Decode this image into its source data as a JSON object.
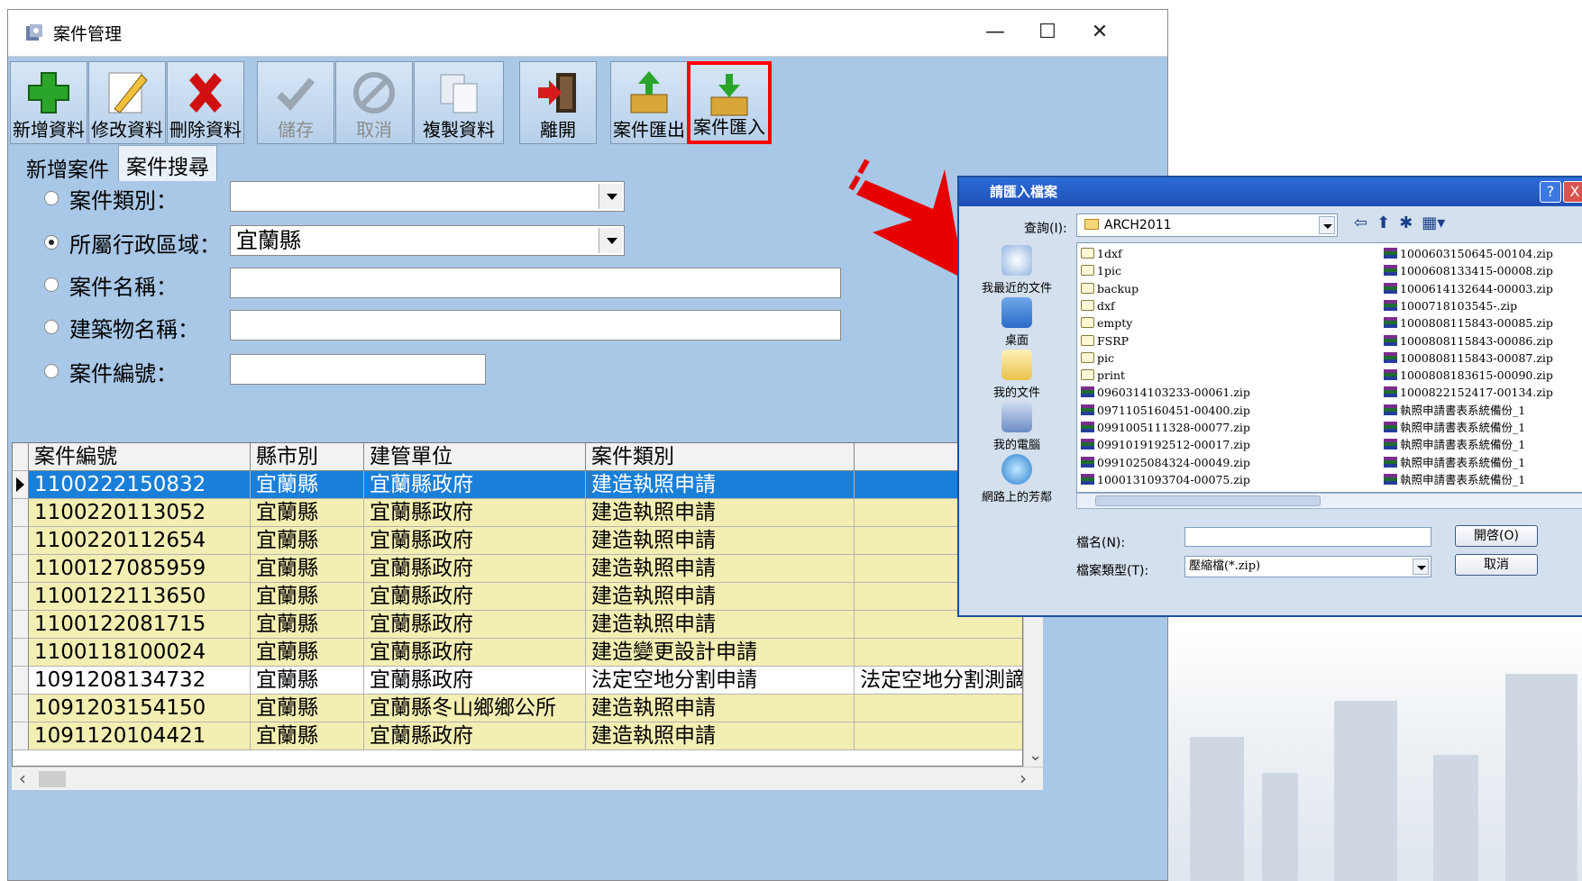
{
  "window": {
    "title": "案件管理",
    "controls": {
      "minimize": "—",
      "maximize": "☐",
      "close": "✕"
    }
  },
  "toolbar": {
    "add": "新增資料",
    "edit": "修改資料",
    "delete": "刪除資料",
    "save": "儲存",
    "cancel": "取消",
    "copy": "複製資料",
    "exit": "離開",
    "export": "案件匯出",
    "import": "案件匯入"
  },
  "tabs": {
    "new_case": "新增案件",
    "search": "案件搜尋"
  },
  "search_form": {
    "case_type_label": "案件類別：",
    "case_type_value": "",
    "district_label": "所屬行政區域：",
    "district_value": "宜蘭縣",
    "case_name_label": "案件名稱：",
    "building_name_label": "建築物名稱：",
    "case_no_label": "案件編號："
  },
  "grid": {
    "columns": [
      "案件編號",
      "縣市別",
      "建管單位",
      "案件類別",
      ""
    ],
    "rows": [
      {
        "cells": [
          "1100222150832",
          "宜蘭縣",
          "宜蘭縣政府",
          "建造執照申請",
          ""
        ],
        "style": "sel"
      },
      {
        "cells": [
          "1100220113052",
          "宜蘭縣",
          "宜蘭縣政府",
          "建造執照申請",
          ""
        ],
        "style": "yellow"
      },
      {
        "cells": [
          "1100220112654",
          "宜蘭縣",
          "宜蘭縣政府",
          "建造執照申請",
          ""
        ],
        "style": "yellow"
      },
      {
        "cells": [
          "1100127085959",
          "宜蘭縣",
          "宜蘭縣政府",
          "建造執照申請",
          ""
        ],
        "style": "yellow"
      },
      {
        "cells": [
          "1100122113650",
          "宜蘭縣",
          "宜蘭縣政府",
          "建造執照申請",
          ""
        ],
        "style": "yellow"
      },
      {
        "cells": [
          "1100122081715",
          "宜蘭縣",
          "宜蘭縣政府",
          "建造執照申請",
          ""
        ],
        "style": "yellow"
      },
      {
        "cells": [
          "1100118100024",
          "宜蘭縣",
          "宜蘭縣政府",
          "建造變更設計申請",
          ""
        ],
        "style": "yellow"
      },
      {
        "cells": [
          "1091208134732",
          "宜蘭縣",
          "宜蘭縣政府",
          "法定空地分割申請",
          "法定空地分割測謫"
        ],
        "style": "white"
      },
      {
        "cells": [
          "1091203154150",
          "宜蘭縣",
          "宜蘭縣冬山鄉鄉公所",
          "建造執照申請",
          ""
        ],
        "style": "yellow"
      },
      {
        "cells": [
          "1091120104421",
          "宜蘭縣",
          "宜蘭縣政府",
          "建造執照申請",
          ""
        ],
        "style": "yellow"
      }
    ]
  },
  "dialog": {
    "title": "請匯入檔案",
    "help": "?",
    "close": "X",
    "look_in_label": "查詢(I):",
    "look_in_value": "ARCH2011",
    "places": [
      "我最近的文件",
      "桌面",
      "我的文件",
      "我的電腦",
      "網路上的芳鄰"
    ],
    "files_col1": [
      {
        "name": "1dxf",
        "type": "folder"
      },
      {
        "name": "1pic",
        "type": "folder"
      },
      {
        "name": "backup",
        "type": "folder"
      },
      {
        "name": "dxf",
        "type": "folder"
      },
      {
        "name": "empty",
        "type": "folder"
      },
      {
        "name": "FSRP",
        "type": "folder"
      },
      {
        "name": "pic",
        "type": "folder"
      },
      {
        "name": "print",
        "type": "folder"
      },
      {
        "name": "0960314103233-00061.zip",
        "type": "zip"
      },
      {
        "name": "0971105160451-00400.zip",
        "type": "zip"
      },
      {
        "name": "0991005111328-00077.zip",
        "type": "zip"
      },
      {
        "name": "0991019192512-00017.zip",
        "type": "zip"
      },
      {
        "name": "0991025084324-00049.zip",
        "type": "zip"
      },
      {
        "name": "1000131093704-00075.zip",
        "type": "zip"
      }
    ],
    "files_col2": [
      {
        "name": "1000603150645-00104.zip",
        "type": "zip"
      },
      {
        "name": "1000608133415-00008.zip",
        "type": "zip"
      },
      {
        "name": "1000614132644-00003.zip",
        "type": "zip"
      },
      {
        "name": "1000718103545-.zip",
        "type": "zip"
      },
      {
        "name": "1000808115843-00085.zip",
        "type": "zip"
      },
      {
        "name": "1000808115843-00086.zip",
        "type": "zip"
      },
      {
        "name": "1000808115843-00087.zip",
        "type": "zip"
      },
      {
        "name": "1000808183615-00090.zip",
        "type": "zip"
      },
      {
        "name": "1000822152417-00134.zip",
        "type": "zip"
      },
      {
        "name": "執照申請書表系統備份_1",
        "type": "zip"
      },
      {
        "name": "執照申請書表系統備份_1",
        "type": "zip"
      },
      {
        "name": "執照申請書表系統備份_1",
        "type": "zip"
      },
      {
        "name": "執照申請書表系統備份_1",
        "type": "zip"
      },
      {
        "name": "執照申請書表系統備份_1",
        "type": "zip"
      }
    ],
    "filename_label": "檔名(N):",
    "filename_value": "",
    "filetype_label": "檔案類型(T):",
    "filetype_value": "壓縮檔(*.zip)",
    "open_button": "開啓(O)",
    "cancel_button": "取消"
  }
}
